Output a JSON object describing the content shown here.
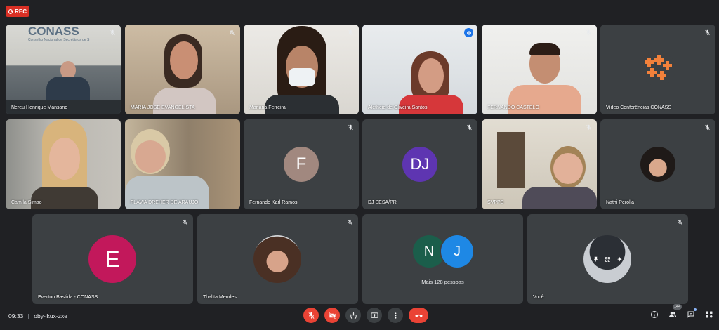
{
  "recording": {
    "label": "REC"
  },
  "participants": [
    {
      "name": "Nereu Henrique Mansano"
    },
    {
      "name": "MARIA JOSE EVANGELISTA"
    },
    {
      "name": "Mariana Ferreira"
    },
    {
      "name": "Aletheia de Oliveira Santos"
    },
    {
      "name": "FERNANDO CASTELO"
    },
    {
      "name": "Vídeo Conferências CONASS"
    },
    {
      "name": "Camila Simao"
    },
    {
      "name": "FLAVIA DREHER DE ARAUJO"
    },
    {
      "name": "Fernando Karl Ramos",
      "initial": "F"
    },
    {
      "name": "DJ SESA/PR",
      "initial": "DJ"
    },
    {
      "name": "SVPPS"
    },
    {
      "name": "Nathi Perolla"
    },
    {
      "name": "Everton Bastida - CONASS",
      "initial": "E"
    },
    {
      "name": "Thalita Mendes"
    },
    {
      "name": "Mais 128 pessoas",
      "initials": [
        "N",
        "J"
      ]
    },
    {
      "name": "Você"
    }
  ],
  "conass_logo_text": "CONASS",
  "conass_subtitle": "Conselho Nacional de Secretários de S",
  "meeting": {
    "time": "09:33",
    "separator": "|",
    "code": "oby-ikux-zxe"
  },
  "people_count": "144",
  "colors": {
    "background": "#202124",
    "tile": "#3c4043",
    "danger": "#ea4335",
    "speaking": "#1a73e8",
    "avatar_f": "#a1887f",
    "avatar_dj": "#5e35b1",
    "avatar_e": "#c2185b",
    "avatar_n": "#1b5e4b",
    "avatar_j": "#1e88e5",
    "conass_orange": "#f2813b"
  },
  "icons": {
    "rec": "rec-icon",
    "mic_off": "mic-off-icon",
    "camera_off": "camera-off-icon",
    "hand": "raise-hand-icon",
    "present": "present-icon",
    "more": "more-vert-icon",
    "leave": "call-end-icon",
    "info": "info-icon",
    "people": "people-icon",
    "chat": "chat-icon",
    "activities": "activities-icon"
  }
}
